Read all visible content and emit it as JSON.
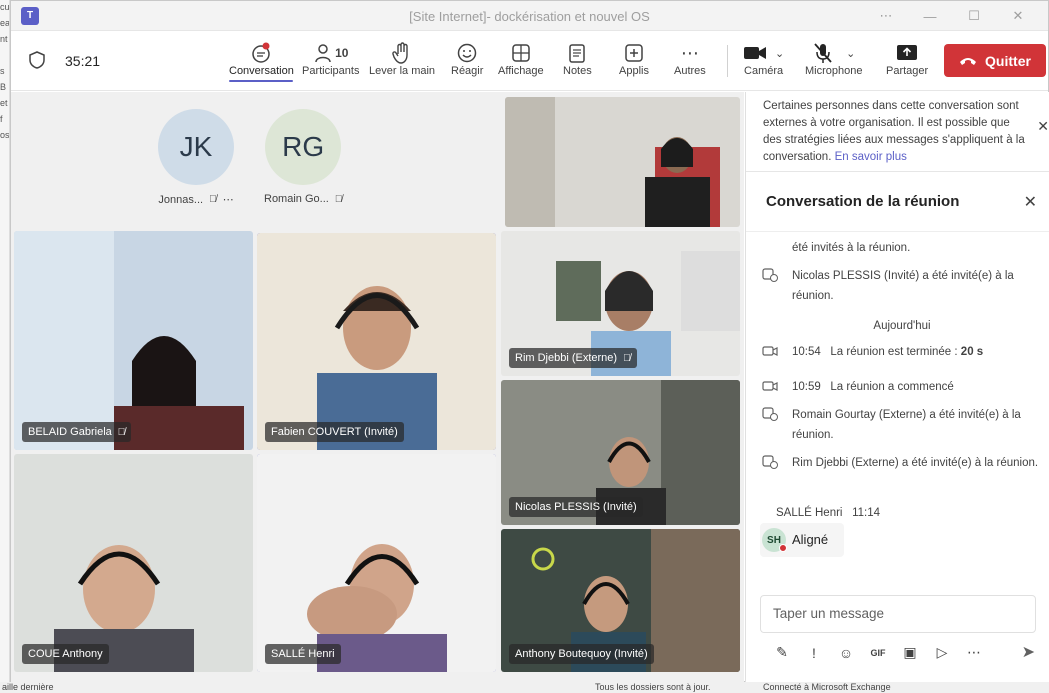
{
  "window": {
    "title": "[Site Internet]- dockérisation et nouvel OS",
    "controls": [
      "⋯",
      "—",
      "☐",
      "✕"
    ]
  },
  "meeting": {
    "timer": "35:21"
  },
  "toolbar": {
    "conversation": "Conversation",
    "participants": "Participants",
    "participants_count": "10",
    "raise_hand": "Lever la main",
    "react": "Réagir",
    "view": "Affichage",
    "notes": "Notes",
    "apps": "Applis",
    "more": "Autres",
    "camera": "Caméra",
    "microphone": "Microphone",
    "share": "Partager",
    "leave": "Quitter"
  },
  "audio_participants": [
    {
      "initials": "JK",
      "name": "Jonnas...",
      "color": "#cfdce8"
    },
    {
      "initials": "RG",
      "name": "Romain Go...",
      "color": "#dde6d6"
    }
  ],
  "video_tiles": {
    "belaid": "BELAID Gabriela",
    "fabien": "Fabien COUVERT (Invité)",
    "rim": "Rim Djebbi (Externe)",
    "nicolas": "Nicolas PLESSIS (Invité)",
    "coue": "COUE Anthony",
    "salle": "SALLÉ Henri",
    "anthony_b": "Anthony Boutequoy (Invité)"
  },
  "chat": {
    "banner": "Certaines personnes dans cette conversation sont externes à votre organisation. Il est possible que des stratégies liées aux messages s'appliquent à la conversation.",
    "banner_link": "En savoir plus",
    "title": "Conversation de la réunion",
    "events": [
      {
        "text": "été invités à la réunion."
      },
      {
        "text": "Nicolas PLESSIS (Invité) a été invité(e) à la réunion."
      },
      {
        "text": "Aujourd'hui"
      },
      {
        "time": "10:54",
        "text": "La réunion est terminée : ",
        "bold": "20 s"
      },
      {
        "time": "10:59",
        "text": "La réunion a commencé"
      },
      {
        "text": "Romain Gourtay (Externe) a été invité(e) à la réunion."
      },
      {
        "text": "Rim Djebbi (Externe) a été invité(e) à la réunion."
      }
    ],
    "message": {
      "author": "SALLÉ Henri",
      "time": "11:14",
      "initials": "SH",
      "text": "Aligné"
    },
    "compose_placeholder": "Taper un message"
  },
  "background_app": {
    "status_left": "aille dernière",
    "status_mid": "Tous les dossiers sont à jour.",
    "status_right": "Connecté à Microsoft Exchange"
  }
}
